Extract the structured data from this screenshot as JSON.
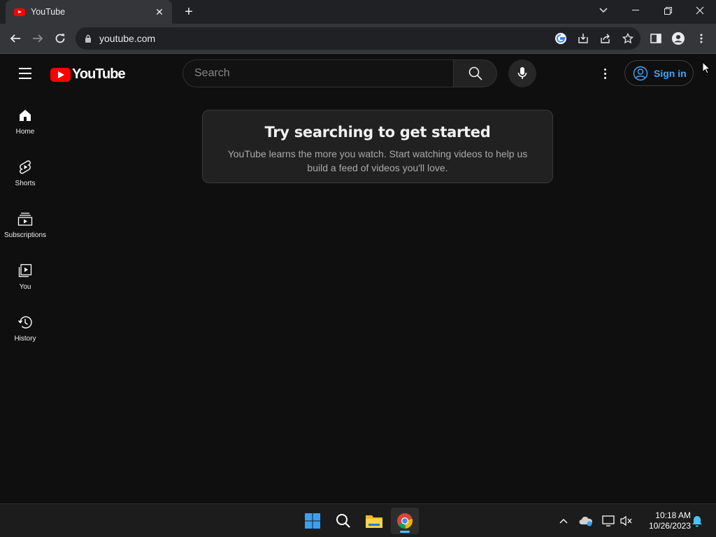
{
  "browser": {
    "tab_title": "YouTube",
    "tab_close": "✕",
    "new_tab": "+",
    "url": "youtube.com"
  },
  "header": {
    "logo_text": "YouTube",
    "search_placeholder": "Search",
    "signin_label": "Sign in"
  },
  "sidebar": {
    "items": [
      {
        "label": "Home",
        "icon": "home-icon"
      },
      {
        "label": "Shorts",
        "icon": "shorts-icon"
      },
      {
        "label": "Subscriptions",
        "icon": "subscriptions-icon"
      },
      {
        "label": "You",
        "icon": "you-icon"
      },
      {
        "label": "History",
        "icon": "history-icon"
      }
    ]
  },
  "main": {
    "heading": "Try searching to get started",
    "body": "YouTube learns the more you watch. Start watching videos to help us build a feed of videos you'll love."
  },
  "taskbar": {
    "time": "10:18 AM",
    "date": "10/26/2023"
  },
  "colors": {
    "brand_red": "#ff0000",
    "link_blue": "#3ea6ff",
    "background": "#0f0f0f"
  }
}
